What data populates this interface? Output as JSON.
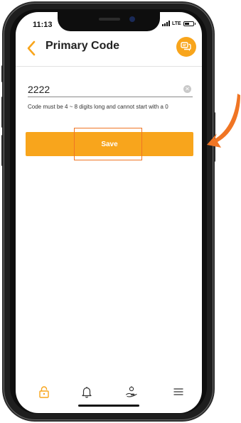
{
  "status_bar": {
    "time": "11:13",
    "network": "LTE",
    "battery_percent": 60
  },
  "header": {
    "title": "Primary Code"
  },
  "form": {
    "code_value": "2222",
    "hint": "Code must be 4 ~ 8 digits long and cannot start with a 0",
    "save_label": "Save"
  },
  "tab_bar": {
    "items": [
      "lock-icon",
      "bell-icon",
      "hand-icon",
      "menu-icon"
    ],
    "active": "lock-icon"
  },
  "colors": {
    "accent": "#f8a51c",
    "highlight": "#f07524"
  }
}
